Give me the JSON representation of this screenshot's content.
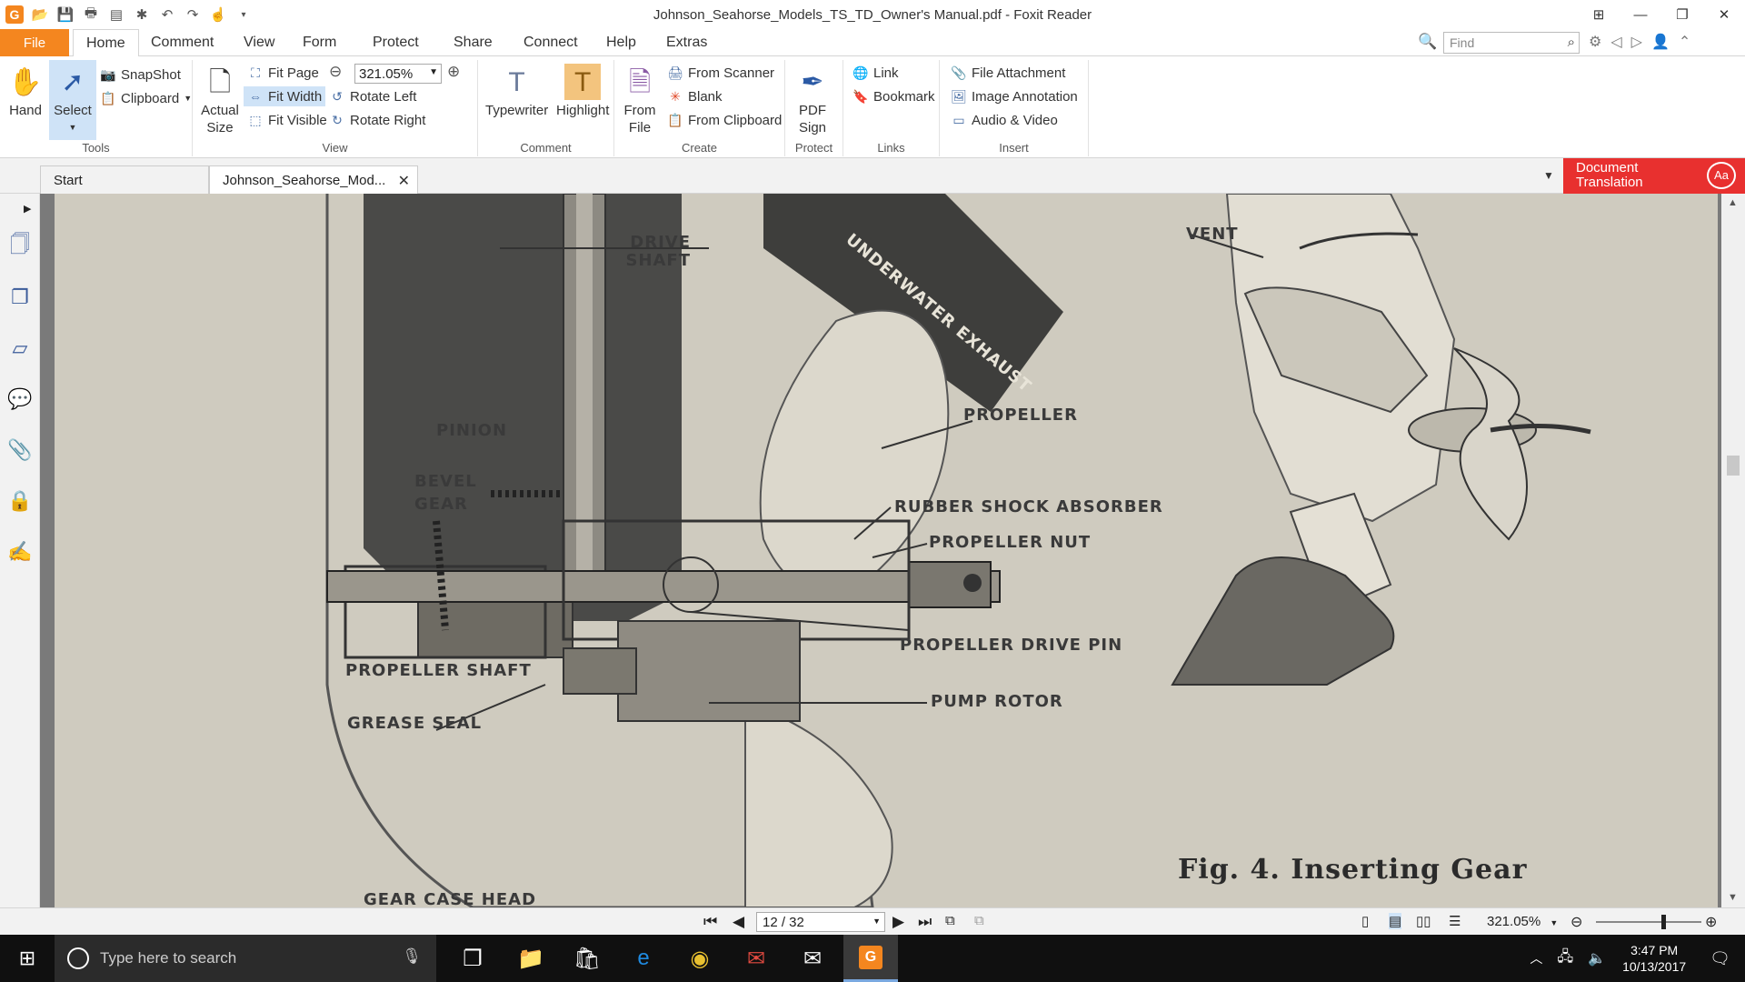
{
  "window": {
    "title": "Johnson_Seahorse_Models_TS_TD_Owner's Manual.pdf - Foxit Reader",
    "logo": "G"
  },
  "ribbon_tabs": {
    "file": "File",
    "tabs": [
      "Home",
      "Comment",
      "View",
      "Form",
      "Protect",
      "Share",
      "Connect",
      "Help",
      "Extras"
    ],
    "active": "Home"
  },
  "find": {
    "placeholder": "Find"
  },
  "tools": {
    "hand": "Hand",
    "select": "Select",
    "snapshot": "SnapShot",
    "clipboard": "Clipboard",
    "label": "Tools"
  },
  "view": {
    "actual_size": "Actual Size",
    "fit_page": "Fit Page",
    "fit_width": "Fit Width",
    "fit_visible": "Fit Visible",
    "zoom_value": "321.05%",
    "rotate_left": "Rotate Left",
    "rotate_right": "Rotate Right",
    "label": "View"
  },
  "comment": {
    "typewriter": "Typewriter",
    "highlight": "Highlight",
    "label": "Comment"
  },
  "create": {
    "from_file": "From File",
    "from_scanner": "From Scanner",
    "blank": "Blank",
    "from_clipboard": "From Clipboard",
    "label": "Create"
  },
  "protect": {
    "pdf_sign": "PDF Sign",
    "label": "Protect"
  },
  "links": {
    "link": "Link",
    "bookmark": "Bookmark",
    "label": "Links"
  },
  "insert": {
    "file_attachment": "File Attachment",
    "image_annotation": "Image Annotation",
    "audio_video": "Audio & Video",
    "label": "Insert"
  },
  "doc_tabs": {
    "start": "Start",
    "document": "Johnson_Seahorse_Mod...",
    "translation": "Document Translation"
  },
  "page_content": {
    "labels": {
      "drive_shaft": "DRIVE SHAFT",
      "underwater_exhaust": "UNDERWATER EXHAUST",
      "vent": "VENT",
      "propeller": "PROPELLER",
      "pinion": "PINION",
      "bevel_gear": "BEVEL GEAR",
      "rubber_shock_absorber": "RUBBER SHOCK ABSORBER",
      "propeller_nut": "PROPELLER NUT",
      "propeller_drive_pin": "PROPELLER DRIVE PIN",
      "propeller_shaft": "PROPELLER SHAFT",
      "pump_rotor": "PUMP ROTOR",
      "grease_seal": "GREASE SEAL",
      "gear_case_head": "GEAR CASE HEAD"
    },
    "caption": "Fig. 4. Inserting Gear"
  },
  "statusbar": {
    "page": "12 / 32",
    "zoom": "321.05%",
    "zoom_level": 0.64
  },
  "taskbar": {
    "search_placeholder": "Type here to search",
    "time": "3:47 PM",
    "date": "10/13/2017"
  }
}
